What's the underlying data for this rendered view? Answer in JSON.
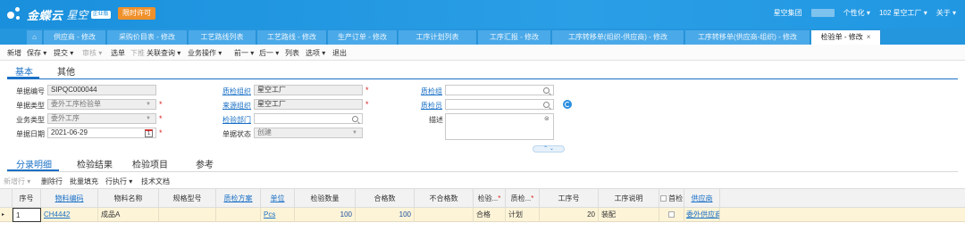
{
  "header": {
    "brand": "金蝶云",
    "product": "星空",
    "edition_badge": "企业版",
    "license_button": "限时许可",
    "group": "星空集团",
    "personalize": "个性化 ▾",
    "org": "102 星空工厂 ▾",
    "about": "关于 ▾"
  },
  "tabs": [
    {
      "label": "供应商 - 修改"
    },
    {
      "label": "采购价目表 - 修改"
    },
    {
      "label": "工艺路线列表"
    },
    {
      "label": "工艺路线 - 修改"
    },
    {
      "label": "生产订单 - 修改"
    },
    {
      "label": "工序计划列表"
    },
    {
      "label": "工序汇报 - 修改"
    },
    {
      "label": "工序转移单(组织-供应商) - 修改"
    },
    {
      "label": "工序转移单(供应商-组织) - 修改"
    },
    {
      "label": "检验单 - 修改"
    }
  ],
  "toolbar": {
    "new": "新增",
    "save": "保存 ▾",
    "submit": "提交 ▾",
    "audit": "审核 ▾",
    "select_bill": "选单",
    "push_down": "下推",
    "related_query": "关联查询 ▾",
    "business_ops": "业务操作 ▾",
    "prev": "前一 ▾",
    "next": "后一 ▾",
    "list": "列表",
    "options": "选项 ▾",
    "exit": "退出"
  },
  "form_tabs": {
    "basic": "基本",
    "other": "其他"
  },
  "form": {
    "bill_no_label": "单据编号",
    "bill_no": "SIPQC000044",
    "bill_type_label": "单据类型",
    "bill_type": "委外工序检验单",
    "biz_type_label": "业务类型",
    "biz_type": "委外工序",
    "bill_date_label": "单据日期",
    "bill_date": "2021-06-29",
    "cal_text": "1",
    "inspect_org_label": "质检组织",
    "inspect_org": "星空工厂",
    "source_org_label": "来源组织",
    "source_org": "星空工厂",
    "inspect_dept_label": "检验部门",
    "inspect_dept": "",
    "bill_status_label": "单据状态",
    "bill_status": "创建",
    "qc_group_label": "质检组",
    "qc_group": "",
    "qc_person_label": "质检员",
    "qc_person": "",
    "desc_label": "描述",
    "desc": "",
    "required_mark": "*"
  },
  "detail_tabs": {
    "entry": "分录明细",
    "result": "检验结果",
    "items": "检验项目",
    "ref": "参考"
  },
  "gridbar": {
    "add_row": "新增行 ▾",
    "delete_row": "删除行",
    "batch_fill": "批量填充",
    "row_exec": "行执行 ▾",
    "tech_doc": "技术文档"
  },
  "grid": {
    "columns": [
      "序号",
      "物料编码",
      "物料名称",
      "规格型号",
      "质检方案",
      "单位",
      "检验数量",
      "合格数",
      "不合格数",
      "检验...",
      "质检...",
      "工序号",
      "工序说明",
      "首检",
      "供应商"
    ],
    "required_mark": "*",
    "row": {
      "seq": "1",
      "material_code": "CH4442",
      "material_name": "成品A",
      "spec": "",
      "scheme": "",
      "unit": "Pcs",
      "inspect_qty": "100",
      "qualified_qty": "100",
      "unqualified_qty": "",
      "inspect_result": "合格",
      "qc_method": "计划",
      "op_no": "20",
      "op_desc": "装配",
      "supplier": "委外供应商"
    }
  }
}
